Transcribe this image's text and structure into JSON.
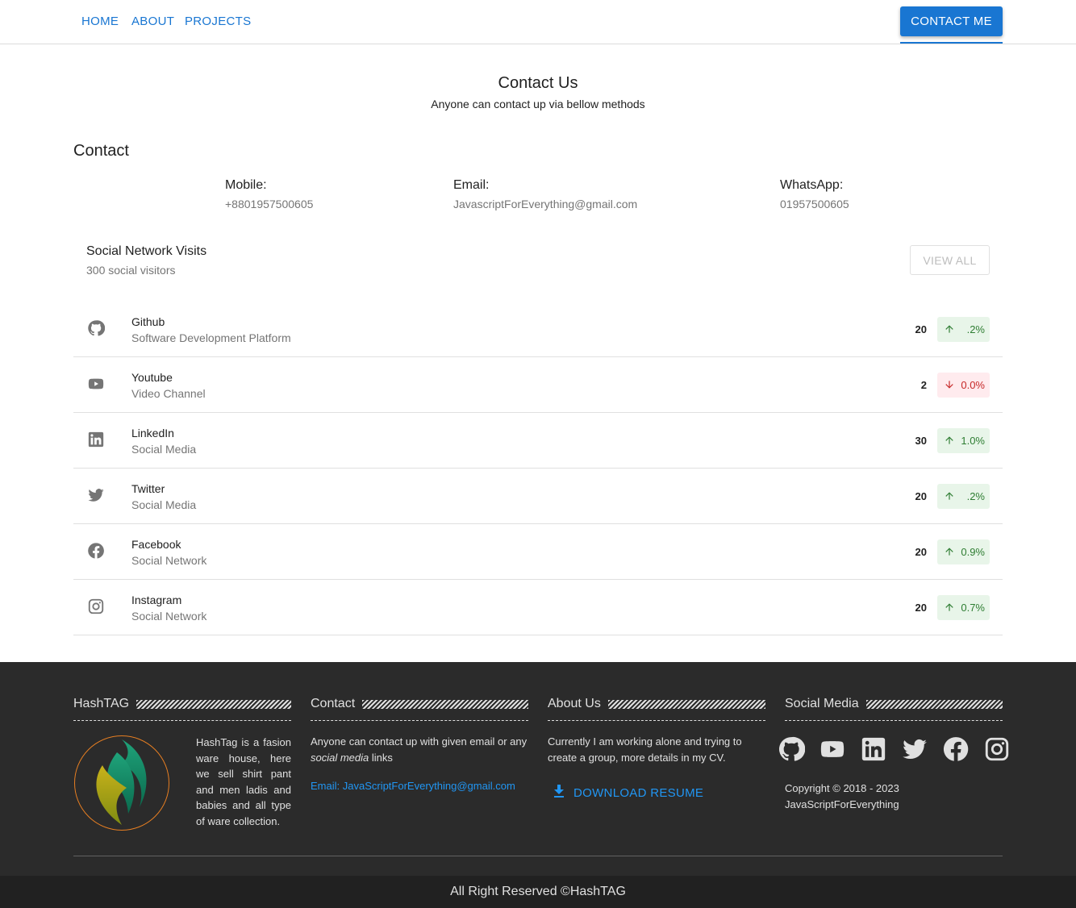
{
  "nav": {
    "links": [
      "HOME",
      "ABOUT",
      "PROJECTS"
    ],
    "cta": "CONTACT ME"
  },
  "hero": {
    "title": "Contact Us",
    "subtitle": "Anyone can contact up via bellow methods"
  },
  "contact": {
    "heading": "Contact",
    "mobile_label": "Mobile:",
    "mobile_value": "+8801957500605",
    "email_label": "Email:",
    "email_value": "JavascriptForEverything@gmail.com",
    "whatsapp_label": "WhatsApp:",
    "whatsapp_value": "01957500605"
  },
  "social_visits": {
    "title": "Social Network Visits",
    "subtitle": "300 social visitors",
    "view_all": "VIEW ALL",
    "rows": [
      {
        "icon": "github-icon",
        "name": "Github",
        "desc": "Software Development Platform",
        "count": "20",
        "trend": "up",
        "change": ".2%"
      },
      {
        "icon": "youtube-icon",
        "name": "Youtube",
        "desc": "Video Channel",
        "count": "2",
        "trend": "down",
        "change": "0.0%"
      },
      {
        "icon": "linkedin-icon",
        "name": "LinkedIn",
        "desc": "Social Media",
        "count": "30",
        "trend": "up",
        "change": "1.0%"
      },
      {
        "icon": "twitter-icon",
        "name": "Twitter",
        "desc": "Social Media",
        "count": "20",
        "trend": "up",
        "change": ".2%"
      },
      {
        "icon": "facebook-icon",
        "name": "Facebook",
        "desc": "Social Network",
        "count": "20",
        "trend": "up",
        "change": "0.9%"
      },
      {
        "icon": "instagram-icon",
        "name": "Instagram",
        "desc": "Social Network",
        "count": "20",
        "trend": "up",
        "change": "0.7%"
      }
    ]
  },
  "footer": {
    "hashtag_title": "HashTAG",
    "hashtag_text": "HashTag is a fasion ware house, here we sell shirt pant and men ladis and babies and all type of ware collection.",
    "contact_title": "Contact",
    "contact_text_pre": "Anyone can contact up with given email or any ",
    "contact_text_em": "social media",
    "contact_text_post": " links",
    "contact_email": "Email: JavaScriptForEverything@gmail.com",
    "about_title": "About Us",
    "about_text": "Currently I am working alone and trying to create a group, more details in my CV.",
    "download_label": "DOWNLOAD RESUME",
    "social_title": "Social Media",
    "social_icons": [
      "github-icon",
      "youtube-icon",
      "linkedin-icon",
      "twitter-icon",
      "facebook-icon",
      "instagram-icon"
    ],
    "copyright_line1": "Copyright © 2018 - 2023",
    "copyright_line2": "JavaScriptForEverything"
  },
  "bottom": {
    "text": "All Right Reserved ©HashTAG"
  },
  "colors": {
    "primary": "#1976d2",
    "footer_bg": "#2b2b2b",
    "bottom_bg": "#212121",
    "up_bg": "#e8f5e9",
    "up_fg": "#2e7d32",
    "down_bg": "#ffebee",
    "down_fg": "#c62828"
  }
}
